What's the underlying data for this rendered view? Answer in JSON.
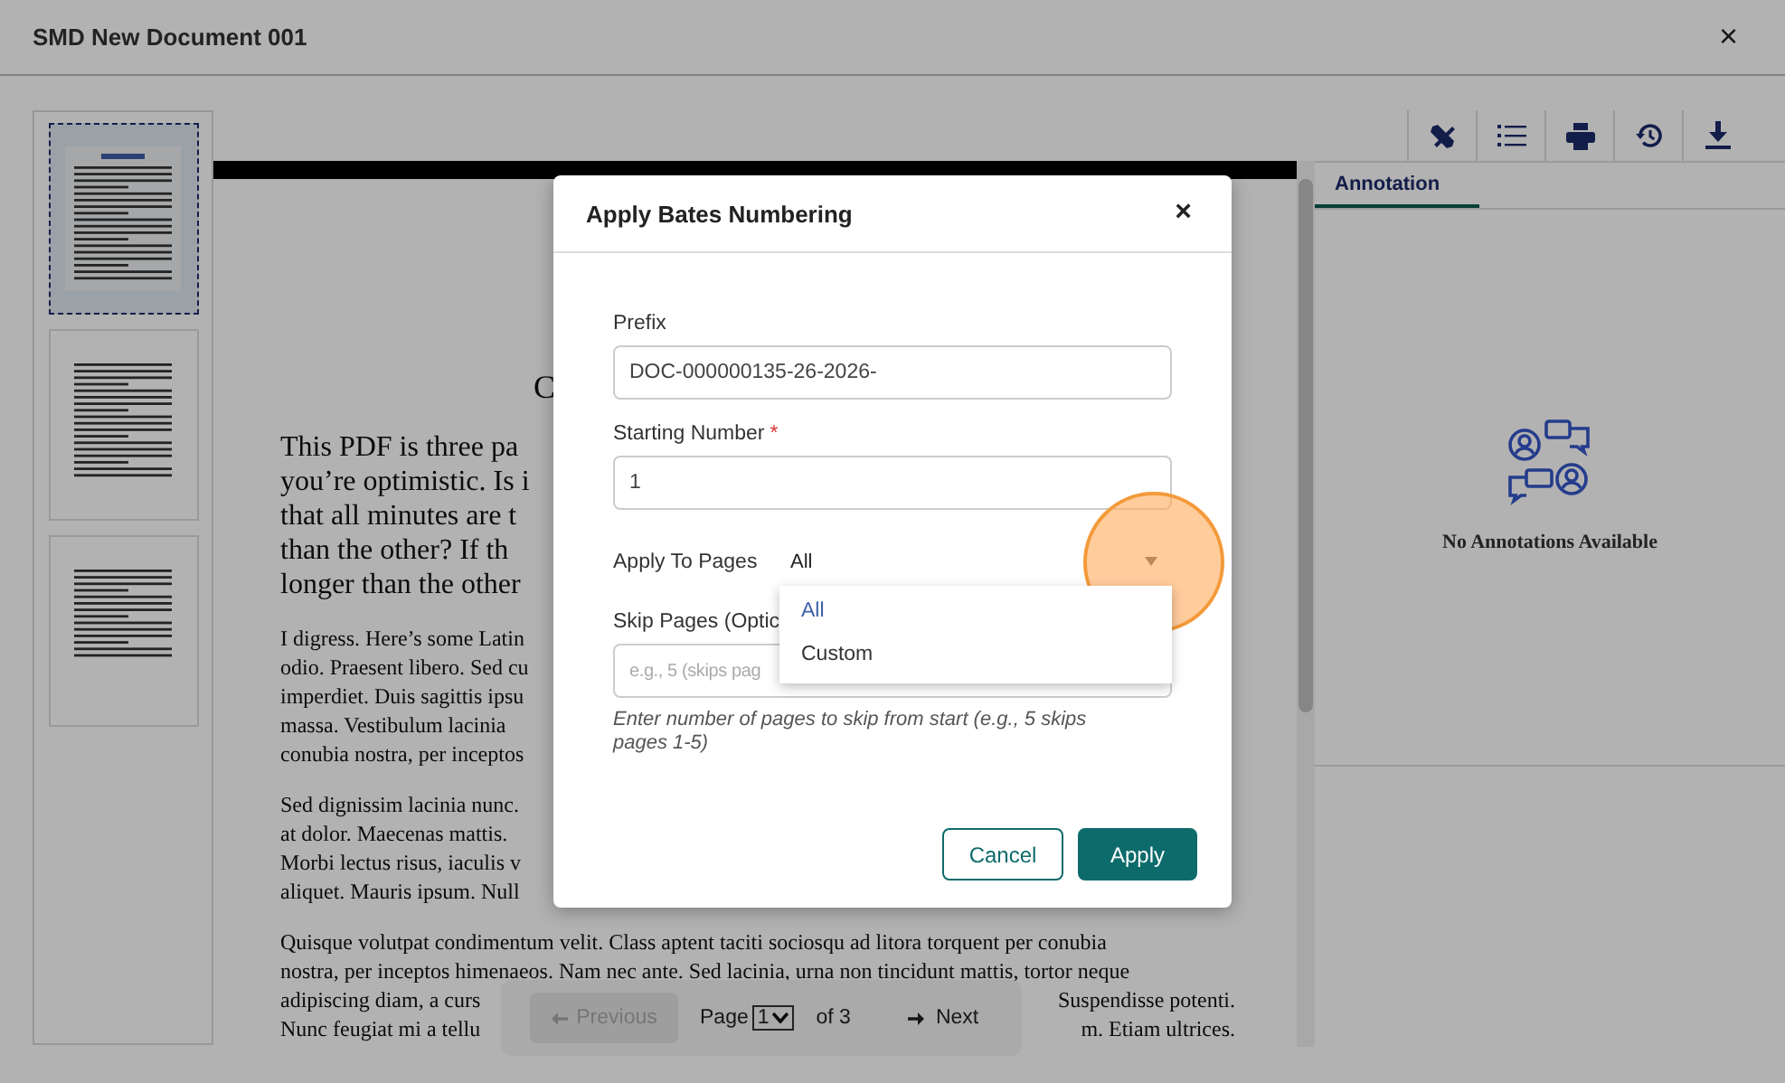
{
  "window": {
    "title": "SMD New Document 001",
    "close": "×"
  },
  "thumbnails": [
    {
      "selected": true
    },
    {
      "selected": false
    },
    {
      "selected": false
    }
  ],
  "document": {
    "heading": "C",
    "paragraphs": [
      {
        "kind": "large",
        "lines": [
          {
            "left": "This PDF is three pa"
          },
          {
            "left": "you’re optimistic. Is i"
          },
          {
            "left": "that all minutes are t"
          },
          {
            "left": "than the other? If th"
          },
          {
            "left": "longer than the other"
          }
        ]
      },
      {
        "kind": "small",
        "lines": [
          {
            "left": "I digress. Here’s some Latin"
          },
          {
            "left": "odio. Praesent libero. Sed cu"
          },
          {
            "left": "imperdiet. Duis sagittis ipsu"
          },
          {
            "left": "massa. Vestibulum lacinia"
          },
          {
            "left": "conubia nostra, per inceptos"
          }
        ]
      },
      {
        "kind": "small",
        "lines": [
          {
            "left": "Sed dignissim lacinia nunc."
          },
          {
            "left": "at dolor. Maecenas mattis."
          },
          {
            "left": "Morbi lectus risus, iaculis v"
          },
          {
            "left": "aliquet. Mauris ipsum. Null"
          }
        ]
      },
      {
        "kind": "small",
        "lines": [
          {
            "left": "Quisque volutpat condimentum velit. Class aptent taciti sociosqu ad litora torquent per conubia"
          },
          {
            "left": "nostra, per inceptos himenaeos. Nam nec ante. Sed lacinia, urna non tincidunt mattis, tortor neque"
          },
          {
            "left": "adipiscing diam, a curs",
            "right": "Suspendisse potenti."
          },
          {
            "left": "Nunc feugiat mi a tellu",
            "right": "m. Etiam ultrices."
          }
        ]
      }
    ]
  },
  "tabs": [
    {
      "label": "Annotation",
      "selected": true
    }
  ],
  "annotations": {
    "empty_text": "No Annotations Available"
  },
  "pagination": {
    "previous": "Previous",
    "previous_disabled": true,
    "page_label": "Page",
    "page": "1",
    "of": "of 3",
    "next": "Next"
  },
  "dialog": {
    "title": "Apply Bates Numbering",
    "close": "×",
    "fields": [
      {
        "kind": "text",
        "label": "Prefix",
        "value": "DOC-000000135-26-2026-"
      },
      {
        "kind": "text",
        "label": "Starting Number",
        "required_mark": "*",
        "value": "1"
      },
      {
        "kind": "select",
        "label": "Apply To Pages",
        "value": "All",
        "expanded": true,
        "options": [
          {
            "label": "All",
            "selected": true
          },
          {
            "label": "Custom",
            "selected": false
          }
        ]
      },
      {
        "kind": "text",
        "label": "Skip Pages (Optic",
        "placeholder": "e.g., 5 (skips pag",
        "help": "Enter number of pages to skip from start (e.g., 5 skips pages 1-5)"
      }
    ],
    "buttons": [
      {
        "kind": "secondary",
        "label": "Cancel"
      },
      {
        "kind": "primary",
        "label": "Apply"
      }
    ]
  }
}
